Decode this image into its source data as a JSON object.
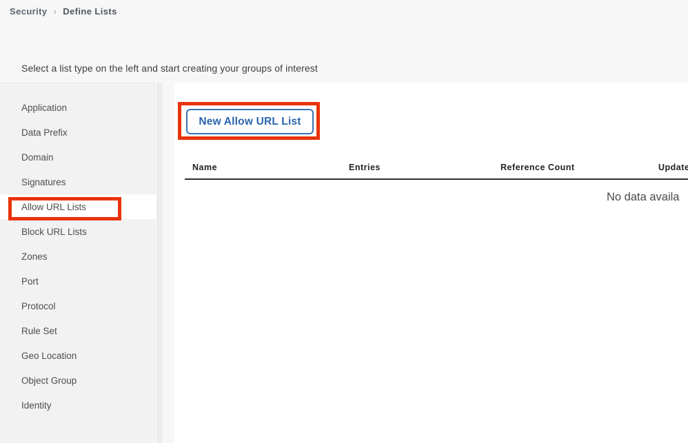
{
  "breadcrumb": {
    "parent": "Security",
    "separator": "›",
    "current": "Define Lists"
  },
  "page": {
    "subtitle": "Select a list type on the left and start creating your groups of interest"
  },
  "sidebar": {
    "items": [
      {
        "label": "Application",
        "selected": false
      },
      {
        "label": "Data Prefix",
        "selected": false
      },
      {
        "label": "Domain",
        "selected": false
      },
      {
        "label": "Signatures",
        "selected": false
      },
      {
        "label": "Allow URL Lists",
        "selected": true
      },
      {
        "label": "Block URL Lists",
        "selected": false
      },
      {
        "label": "Zones",
        "selected": false
      },
      {
        "label": "Port",
        "selected": false
      },
      {
        "label": "Protocol",
        "selected": false
      },
      {
        "label": "Rule Set",
        "selected": false
      },
      {
        "label": "Geo Location",
        "selected": false
      },
      {
        "label": "Object Group",
        "selected": false
      },
      {
        "label": "Identity",
        "selected": false
      }
    ]
  },
  "toolbar": {
    "new_list_label": "New Allow URL List"
  },
  "table": {
    "columns": [
      "Name",
      "Entries",
      "Reference Count",
      "Update"
    ],
    "rows": [],
    "empty_message": "No data availa"
  },
  "annotations": {
    "highlight_color": "#e8340c",
    "boxes": [
      {
        "target": "sidebar-item-allow-url-lists"
      },
      {
        "target": "new-allow-url-list-button"
      }
    ]
  },
  "colors": {
    "page_background": "#f7f7f7",
    "sidebar_background": "#f2f2f2",
    "panel_background": "#ffffff",
    "button_accent": "#2a64ae",
    "annotation_red": "#e8340c"
  }
}
